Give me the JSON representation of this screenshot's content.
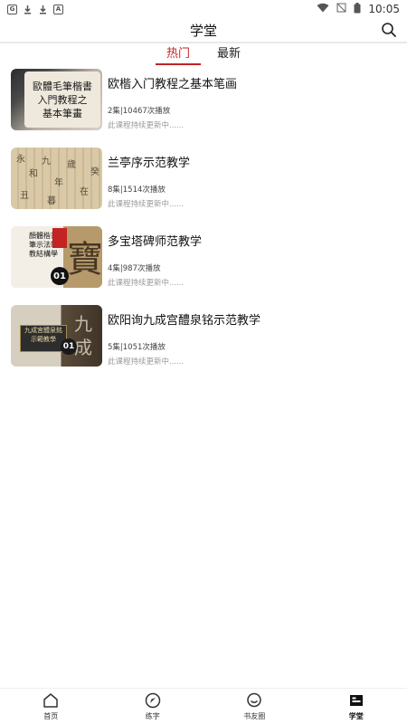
{
  "status_bar": {
    "left_icons": [
      "app-notification-icon",
      "download-icon",
      "download-icon",
      "notification-a-icon"
    ],
    "left_icon_glyph": "A",
    "time": "10:05"
  },
  "header": {
    "title": "学堂",
    "search_icon": "search-icon"
  },
  "tabs": [
    {
      "label": "热门",
      "active": true
    },
    {
      "label": "最新",
      "active": false
    }
  ],
  "courses": [
    {
      "title": "欧楷入门教程之基本笔画",
      "meta": "2集|10467次播放",
      "note": "此课程持续更新中......",
      "thumb_lines": [
        "歐體毛筆楷書",
        "入門教程之",
        "基本筆畫"
      ]
    },
    {
      "title": "兰亭序示范教学",
      "meta": "8集|1514次播放",
      "note": "此课程持续更新中......"
    },
    {
      "title": "多宝塔碑师范教学",
      "meta": "4集|987次播放",
      "note": "此课程持续更新中......",
      "thumb_text": "顏體楷書筆示法範教結構學",
      "thumb_big": "寶",
      "thumb_number": "01"
    },
    {
      "title": "欧阳询九成宫醴泉铭示范教学",
      "meta": "5集|1051次播放",
      "note": "此课程持续更新中......",
      "thumb_box": [
        "九成宮醴泉銘",
        "示範教學"
      ],
      "thumb_number": "01"
    }
  ],
  "bottom_nav": [
    {
      "label": "首页",
      "icon": "home-icon",
      "active": false
    },
    {
      "label": "练字",
      "icon": "compass-icon",
      "active": false
    },
    {
      "label": "书友圈",
      "icon": "chat-icon",
      "active": false
    },
    {
      "label": "学堂",
      "icon": "school-icon",
      "active": true
    }
  ],
  "colors": {
    "accent": "#c42323",
    "text": "#111111",
    "muted": "#9a9a9a"
  }
}
